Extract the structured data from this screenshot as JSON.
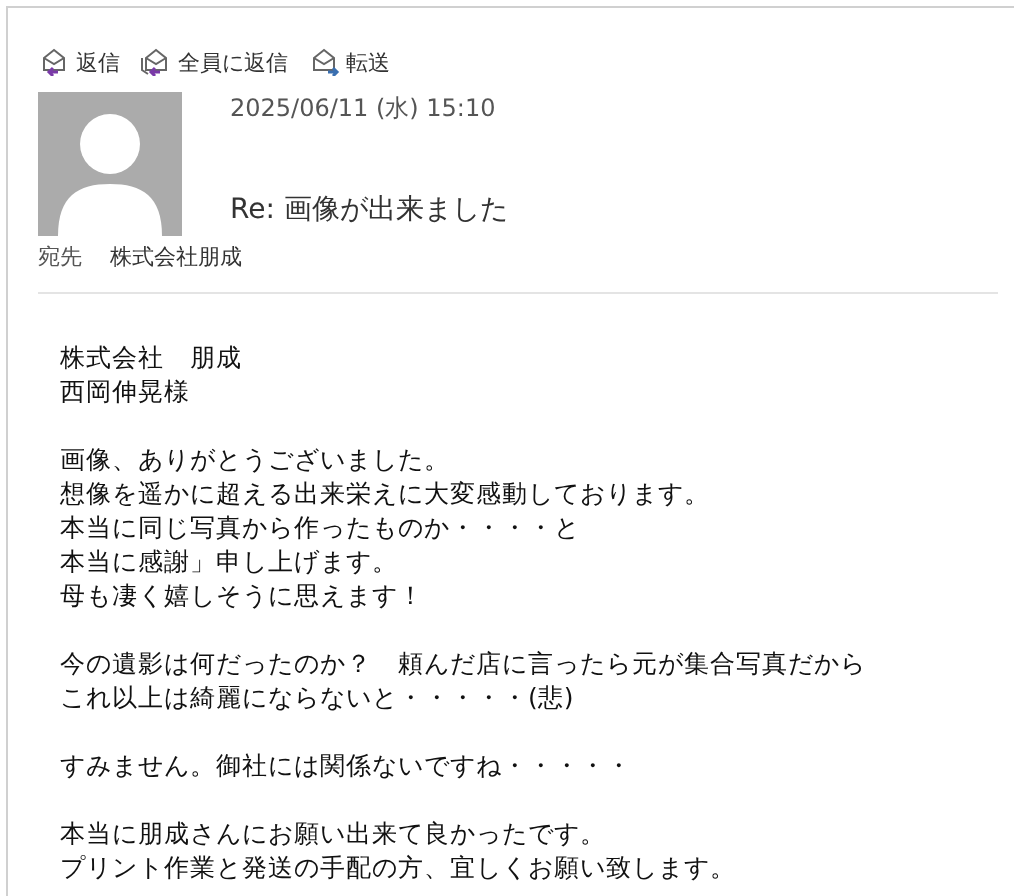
{
  "actions": [
    {
      "kind": "reply",
      "label": "返信"
    },
    {
      "kind": "reply_all",
      "label": "全員に返信"
    },
    {
      "kind": "forward",
      "label": "転送"
    }
  ],
  "message": {
    "date": "2025/06/11 (水) 15:10",
    "subject": "Re: 画像が出来ました",
    "to_label": "宛先",
    "to": "株式会社朋成"
  },
  "body": [
    [
      "株式会社　朋成",
      "西岡伸晃様"
    ],
    [
      "画像、ありがとうございました。",
      "想像を遥かに超える出来栄えに大変感動しております。",
      "本当に同じ写真から作ったものか・・・・と",
      "本当に感謝」申し上げます。",
      "母も凄く嬉しそうに思えます！"
    ],
    [
      "今の遺影は何だったのか？　頼んだ店に言ったら元が集合写真だから",
      "これ以上は綺麗にならないと・・・・・(悲)"
    ],
    [
      "すみません。御社には関係ないですね・・・・・"
    ],
    [
      "本当に朋成さんにお願い出来て良かったです。",
      "プリント作業と発送の手配の方、宜しくお願い致します。"
    ]
  ]
}
